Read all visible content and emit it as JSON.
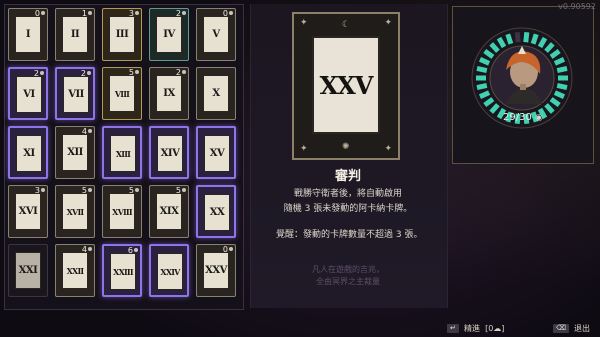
{
  "version": "v0.90592",
  "cards": [
    {
      "numeral": "I",
      "cost": "0",
      "style": "frame"
    },
    {
      "numeral": "II",
      "cost": "1",
      "style": "frame"
    },
    {
      "numeral": "III",
      "cost": "3",
      "style": "gold"
    },
    {
      "numeral": "IV",
      "cost": "2",
      "style": "teal"
    },
    {
      "numeral": "V",
      "cost": "0",
      "style": "frame"
    },
    {
      "numeral": "VI",
      "cost": "2",
      "style": "purple"
    },
    {
      "numeral": "VII",
      "cost": "2",
      "style": "purple"
    },
    {
      "numeral": "VIII",
      "cost": "5",
      "style": "gold"
    },
    {
      "numeral": "IX",
      "cost": "2",
      "style": "frame"
    },
    {
      "numeral": "X",
      "cost": "",
      "style": "frame"
    },
    {
      "numeral": "XI",
      "cost": "",
      "style": "purple"
    },
    {
      "numeral": "XII",
      "cost": "4",
      "style": "frame"
    },
    {
      "numeral": "XIII",
      "cost": "",
      "style": "purple"
    },
    {
      "numeral": "XIV",
      "cost": "",
      "style": "purple"
    },
    {
      "numeral": "XV",
      "cost": "",
      "style": "purple"
    },
    {
      "numeral": "XVI",
      "cost": "3",
      "style": "frame"
    },
    {
      "numeral": "XVII",
      "cost": "5",
      "style": "frame"
    },
    {
      "numeral": "XVIII",
      "cost": "5",
      "style": "frame"
    },
    {
      "numeral": "XIX",
      "cost": "5",
      "style": "frame"
    },
    {
      "numeral": "XX",
      "cost": "",
      "style": "purple"
    },
    {
      "numeral": "XXI",
      "cost": "",
      "style": "dim"
    },
    {
      "numeral": "XXII",
      "cost": "4",
      "style": "frame"
    },
    {
      "numeral": "XXIII",
      "cost": "6",
      "style": "purple"
    },
    {
      "numeral": "XXIV",
      "cost": "",
      "style": "purple"
    },
    {
      "numeral": "XXV",
      "cost": "0",
      "style": "frame"
    }
  ],
  "selected_card": {
    "numeral": "XXV",
    "name": "審判",
    "desc_line1": "戰勝守衛者後，將自動啟用",
    "desc_line2": "隨機 3 張未發動的阿卡納卡牌。",
    "awaken": "覺醒：發動的卡牌數量不超過 3 張。",
    "flavor_line1": "凡人在遊戲的吉兆，",
    "flavor_line2": "全由冥界之主裁量"
  },
  "grasp": {
    "current": 29,
    "max": 30,
    "label": "29/30"
  },
  "footer": {
    "confirm_key": "↵",
    "confirm_label": "精進",
    "confirm_count": "0",
    "exit_key": "⌫",
    "exit_label": "退出"
  },
  "colors": {
    "accent_purple": "#8e74e6",
    "ring_teal": "#3fd1b0",
    "gold": "#b59a55"
  }
}
